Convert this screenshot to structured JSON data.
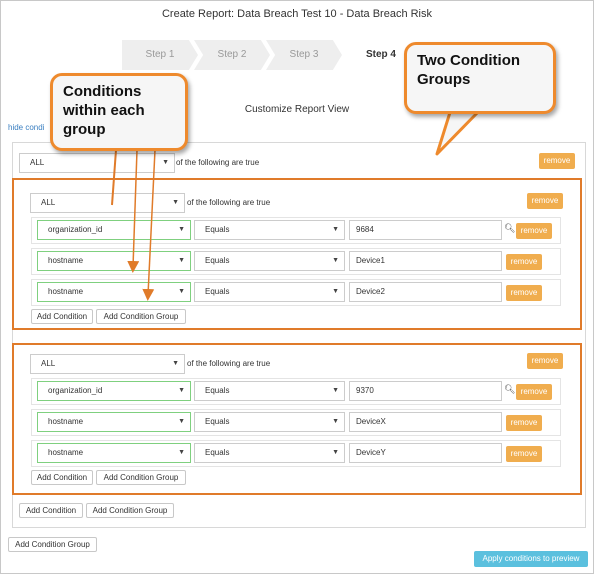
{
  "header": {
    "title": "Create Report: Data Breach Test 10 - Data Breach Risk"
  },
  "steps": [
    {
      "label": "Step 1",
      "active": false
    },
    {
      "label": "Step 2",
      "active": false
    },
    {
      "label": "Step 3",
      "active": false
    },
    {
      "label": "Step 4",
      "active": true
    }
  ],
  "subtitle": "Customize Report View",
  "hide_link": "hide condi",
  "outer": {
    "match": "ALL",
    "following": "of the following are true",
    "remove": "remove"
  },
  "groups": [
    {
      "match": "ALL",
      "following": "of the following are true",
      "remove": "remove",
      "rows": [
        {
          "field": "organization_id",
          "op": "Equals",
          "value": "9684",
          "remove": "remove"
        },
        {
          "field": "hostname",
          "op": "Equals",
          "value": "Device1",
          "remove": "remove"
        },
        {
          "field": "hostname",
          "op": "Equals",
          "value": "Device2",
          "remove": "remove"
        }
      ],
      "add_condition": "Add Condition",
      "add_condition_group": "Add Condition Group"
    },
    {
      "match": "ALL",
      "following": "of the following are true",
      "remove": "remove",
      "rows": [
        {
          "field": "organization_id",
          "op": "Equals",
          "value": "9370",
          "remove": "remove"
        },
        {
          "field": "hostname",
          "op": "Equals",
          "value": "DeviceX",
          "remove": "remove"
        },
        {
          "field": "hostname",
          "op": "Equals",
          "value": "DeviceY",
          "remove": "remove"
        }
      ],
      "add_condition": "Add Condition",
      "add_condition_group": "Add Condition Group"
    }
  ],
  "outer_buttons": {
    "add_condition": "Add Condition",
    "add_condition_group": "Add Condition Group"
  },
  "page_button": "Add Condition Group",
  "apply_button": "Apply conditions to preview",
  "callouts": {
    "conditions": "Conditions within each group",
    "groups": "Two Condition Groups"
  },
  "colors": {
    "highlight": "#e07b2a",
    "remove": "#f0ad4e",
    "apply": "#5bc0de"
  }
}
